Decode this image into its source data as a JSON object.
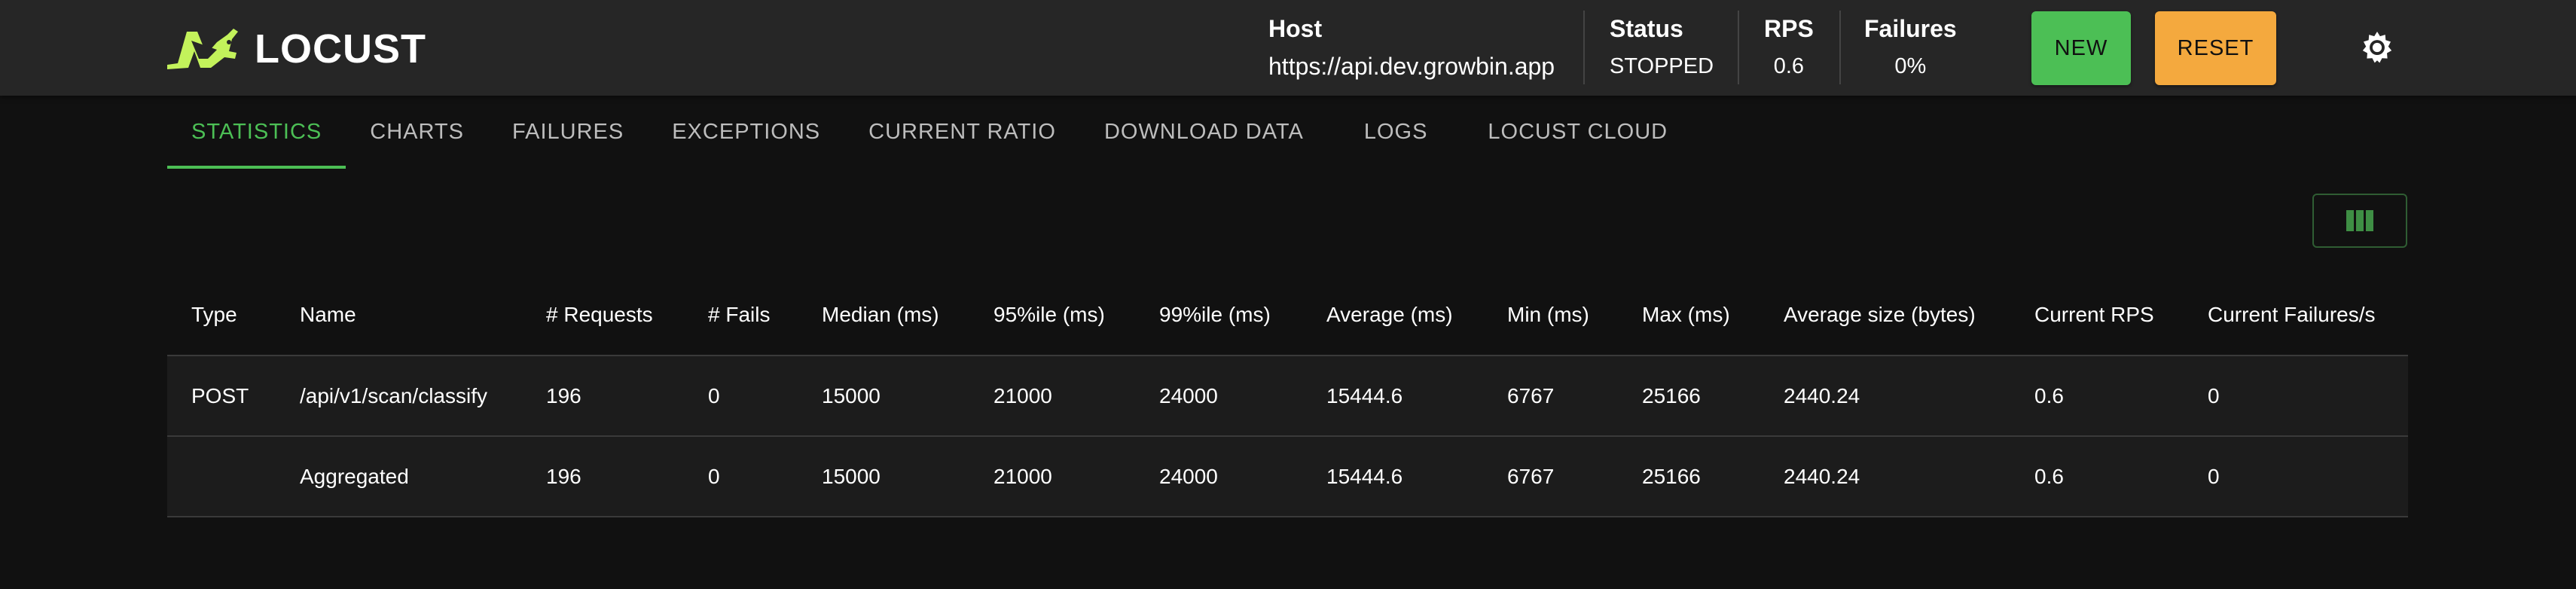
{
  "app": {
    "logo_text": "LOCUST",
    "logo_color": "#c3f25b"
  },
  "header": {
    "host_label": "Host",
    "host_value": "https://api.dev.growbin.app",
    "status_label": "Status",
    "status_value": "STOPPED",
    "rps_label": "RPS",
    "rps_value": "0.6",
    "failures_label": "Failures",
    "failures_value": "0%",
    "new_button": "NEW",
    "reset_button": "RESET",
    "theme_icon": "sun-icon"
  },
  "tabs": [
    {
      "label": "STATISTICS",
      "active": true
    },
    {
      "label": "CHARTS",
      "active": false
    },
    {
      "label": "FAILURES",
      "active": false
    },
    {
      "label": "EXCEPTIONS",
      "active": false
    },
    {
      "label": "CURRENT RATIO",
      "active": false
    },
    {
      "label": "DOWNLOAD DATA",
      "active": false
    },
    {
      "label": "LOGS",
      "active": false
    },
    {
      "label": "LOCUST CLOUD",
      "active": false
    }
  ],
  "toolbar": {
    "columns_icon": "view-columns-icon"
  },
  "table": {
    "columns": [
      "Type",
      "Name",
      "# Requests",
      "# Fails",
      "Median (ms)",
      "95%ile (ms)",
      "99%ile (ms)",
      "Average (ms)",
      "Min (ms)",
      "Max (ms)",
      "Average size (bytes)",
      "Current RPS",
      "Current Failures/s"
    ],
    "rows": [
      [
        "POST",
        "/api/v1/scan/classify",
        "196",
        "0",
        "15000",
        "21000",
        "24000",
        "15444.6",
        "6767",
        "25166",
        "2440.24",
        "0.6",
        "0"
      ],
      [
        "",
        "Aggregated",
        "196",
        "0",
        "15000",
        "21000",
        "24000",
        "15444.6",
        "6767",
        "25166",
        "2440.24",
        "0.6",
        "0"
      ]
    ]
  },
  "colors": {
    "accent_green": "#4cbf55",
    "reset_orange": "#f4a93e",
    "header_bg": "#262626",
    "page_bg": "#111111"
  }
}
